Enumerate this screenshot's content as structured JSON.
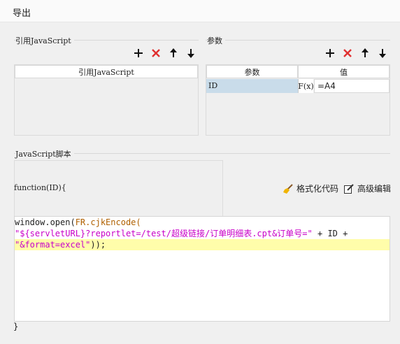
{
  "window": {
    "title": "导出"
  },
  "ref_js": {
    "label": "引用JavaScript",
    "column_header": "引用JavaScript"
  },
  "params": {
    "label": "参数",
    "col_name": "参数",
    "col_value": "值",
    "rows": [
      {
        "name": "ID",
        "formula_icon": "F(x)",
        "value": "=A4"
      }
    ]
  },
  "script": {
    "label": "JavaScript脚本",
    "signature": "function(ID){",
    "format_label": "格式化代码",
    "advanced_label": "高级编辑",
    "line1_a": "window.open(",
    "line1_b": "FR.cjkEncode(",
    "line2_a": "\"${servletURL}?reportlet=/test/超级链接/订单明细表.cpt&订单号=\"",
    "line2_b": " + ID +",
    "line3_a": "\"&format=excel\"",
    "line3_b": "));",
    "closing": "}"
  },
  "colors": {
    "add": "#111111",
    "delete": "#e03030",
    "highlight_line": "#fffdaa",
    "selected_cell": "#c9dcea",
    "string": "#c800c8"
  }
}
